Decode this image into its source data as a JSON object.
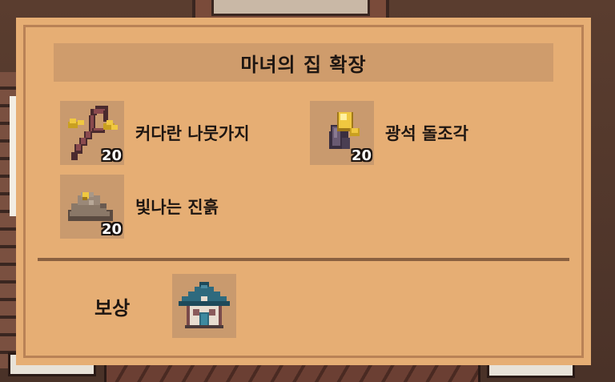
{
  "dialog": {
    "title": "마녀의 집 확장",
    "requirements": [
      {
        "name": "커다란 나뭇가지",
        "quantity": "20",
        "icon": "twig-icon"
      },
      {
        "name": "광석 돌조각",
        "quantity": "20",
        "icon": "ore-chunk-icon"
      },
      {
        "name": "빛나는 진흙",
        "quantity": "20",
        "icon": "glowing-mud-icon"
      }
    ],
    "reward": {
      "label": "보상",
      "icon": "witch-house-icon"
    }
  },
  "colors": {
    "panel": "#e6ae74",
    "panel_border": "#b98256",
    "title_bar": "#cf9c6c",
    "slot": "#c99a6e",
    "divider": "#8a6040",
    "text": "#1e1612"
  }
}
